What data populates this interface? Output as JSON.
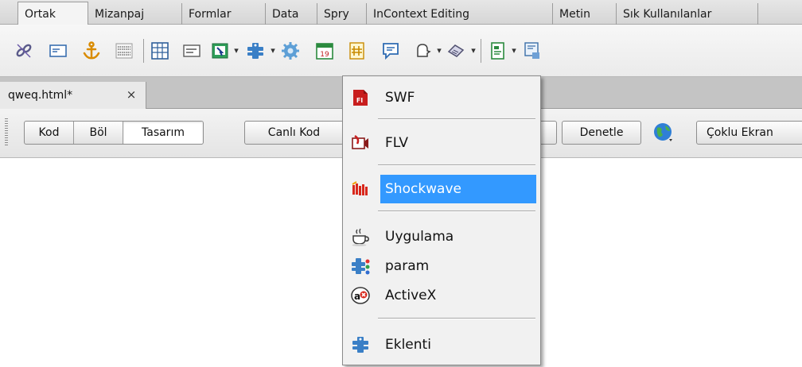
{
  "category_tabs": [
    "Ortak",
    "Mizanpaj",
    "Formlar",
    "Data",
    "Spry",
    "InContext Editing",
    "Metin",
    "Sık Kullanılanlar"
  ],
  "insert_bar": {
    "icons": [
      "hyperlink-icon",
      "email-link-icon",
      "named-anchor-icon",
      "horizontal-rule-icon",
      "table-icon",
      "div-icon",
      "images-icon",
      "media-plugin-icon",
      "widget-icon",
      "date-icon",
      "server-side-include-icon",
      "comment-icon",
      "head-icon",
      "script-icon",
      "templates-icon",
      "tag-chooser-icon"
    ]
  },
  "document": {
    "tab_label": "qweq.html*",
    "close_glyph": "×"
  },
  "doc_toolbar": {
    "view_buttons": [
      "Kod",
      "Böl",
      "Tasarım"
    ],
    "live_code": "Canlı Kod",
    "inspect": "Denetle",
    "multiscreen": "Çoklu Ekran"
  },
  "media_menu": {
    "items": [
      {
        "label": "SWF",
        "icon": "swf-icon"
      },
      {
        "label": "FLV",
        "icon": "flv-icon"
      },
      {
        "label": "Shockwave",
        "icon": "shockwave-icon"
      },
      {
        "label": "Uygulama",
        "icon": "java-applet-icon"
      },
      {
        "label": "param",
        "icon": "param-icon"
      },
      {
        "label": "ActiveX",
        "icon": "activex-icon"
      },
      {
        "label": "Eklenti",
        "icon": "plugin-icon"
      }
    ],
    "highlighted": "Shockwave"
  },
  "colors": {
    "highlight": "#3399ff",
    "menu_bg": "#f1f1f1"
  }
}
